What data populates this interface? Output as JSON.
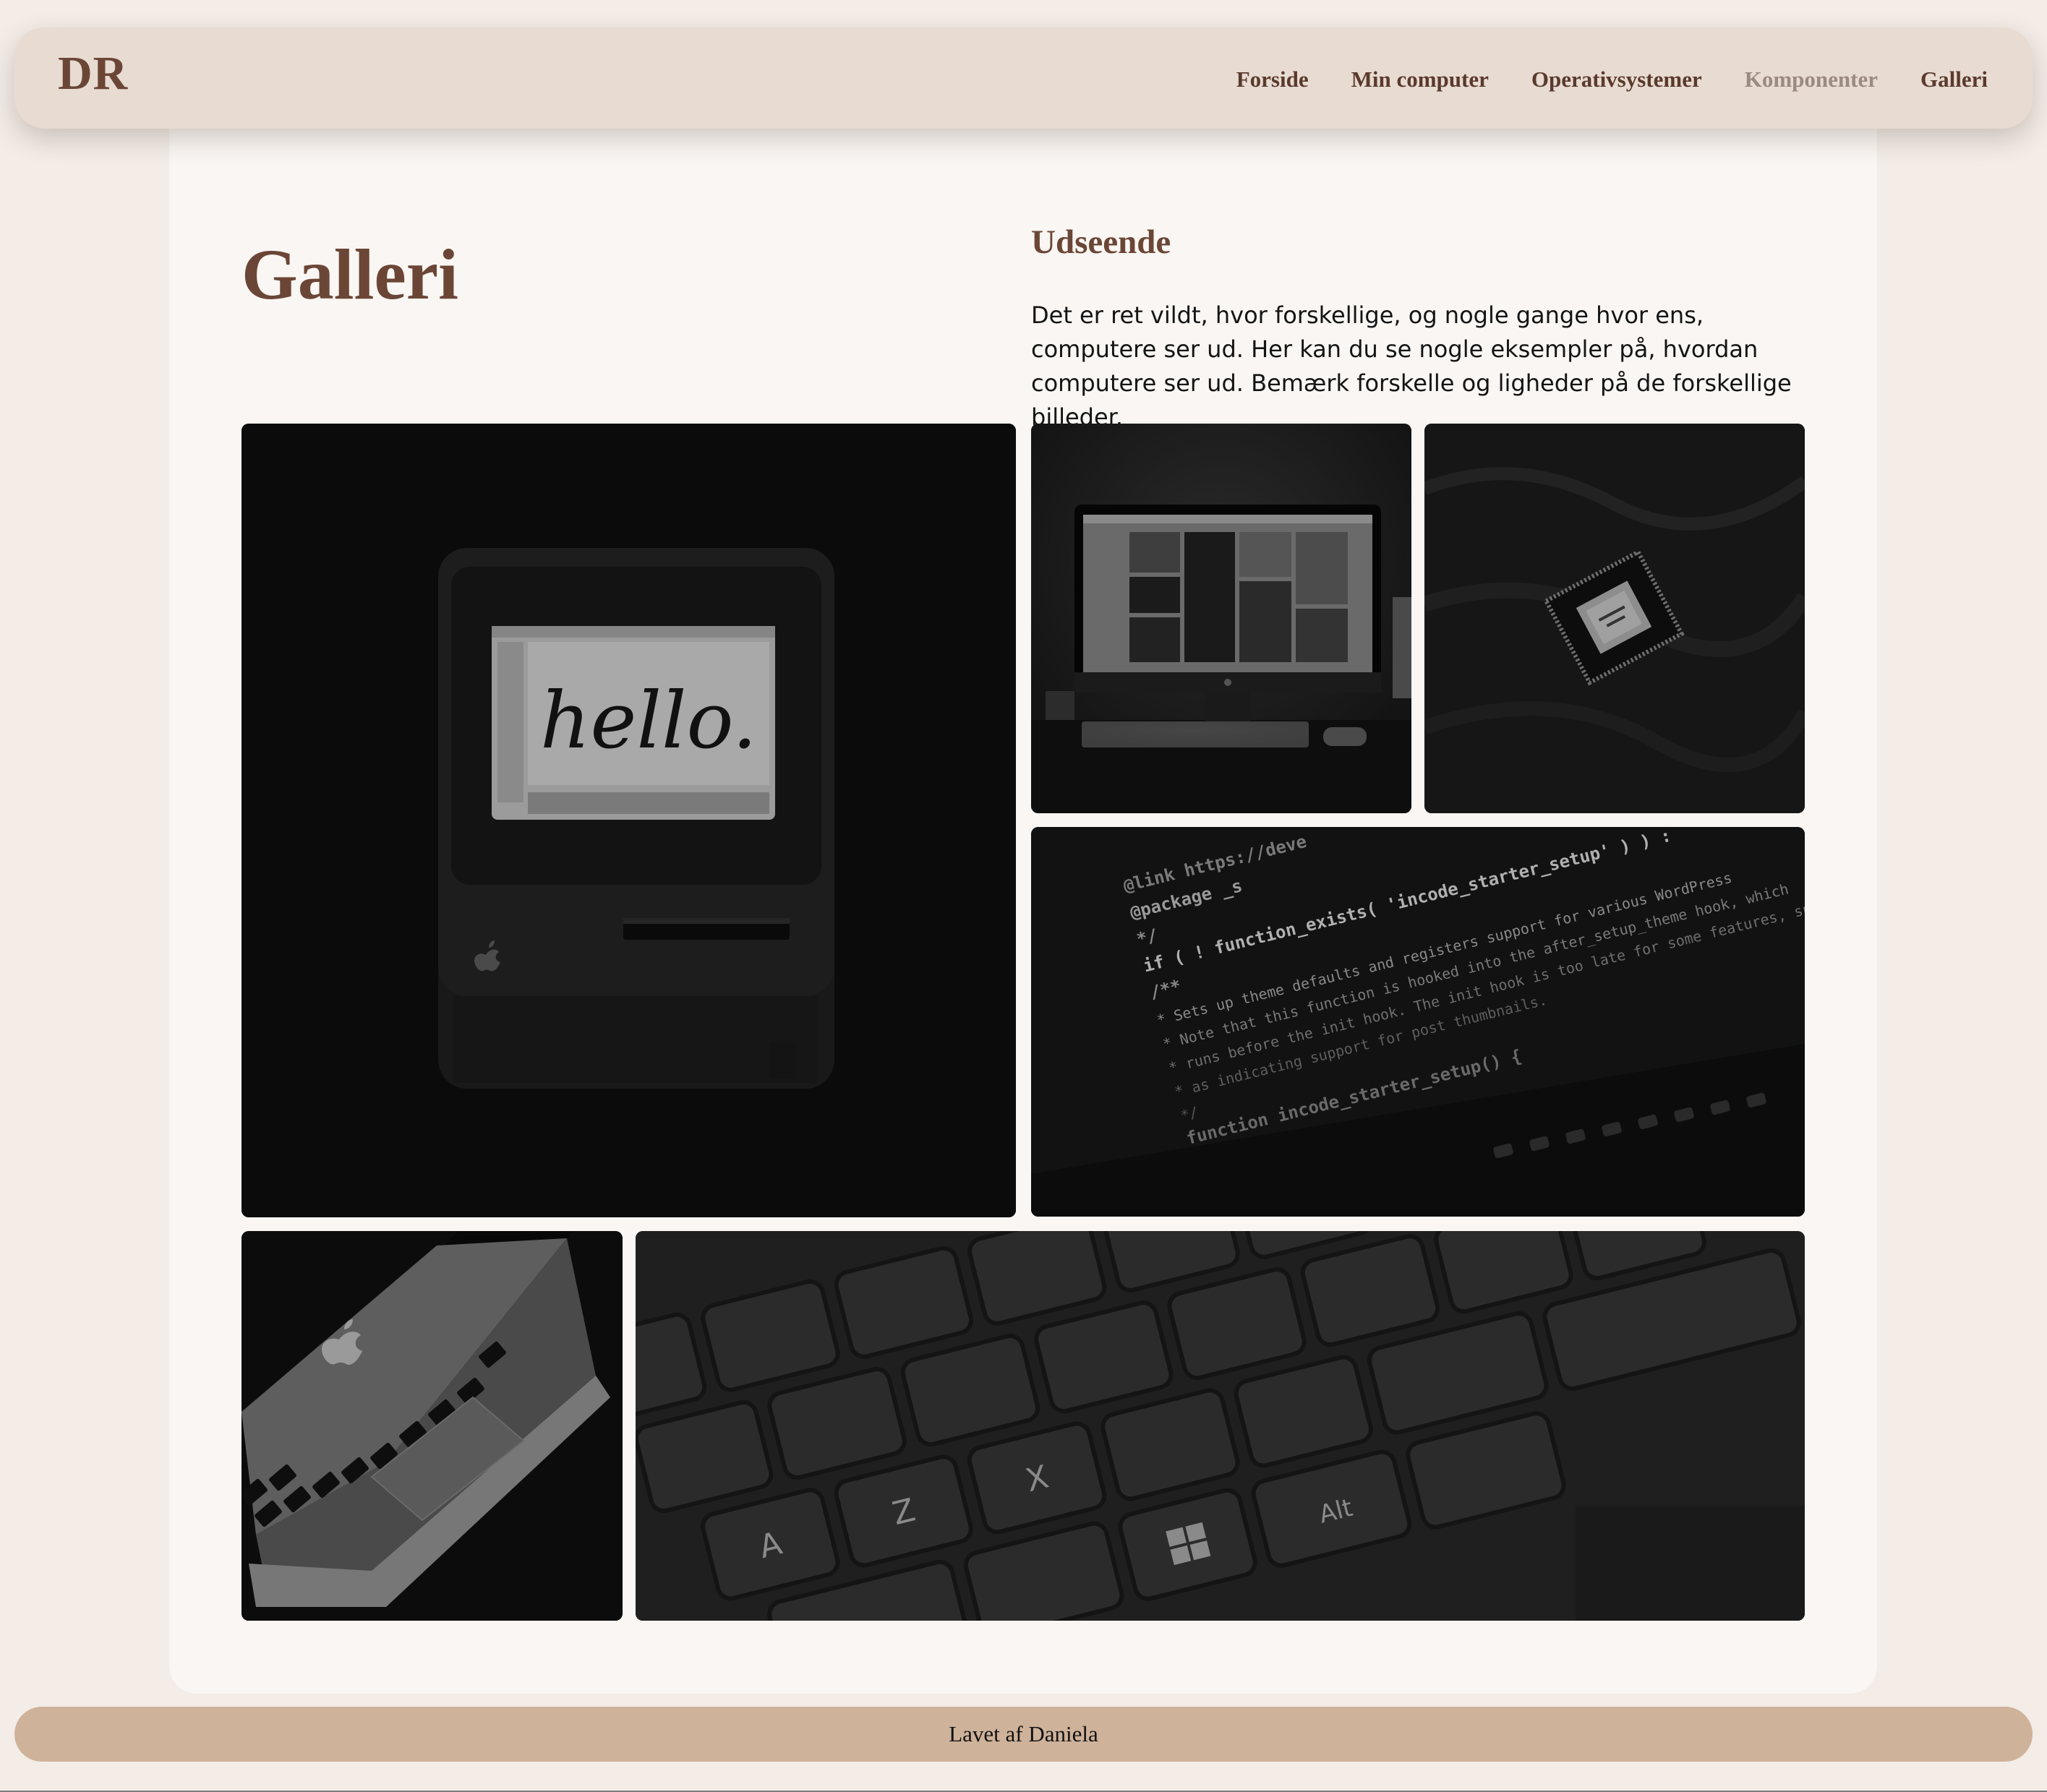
{
  "header": {
    "logo": "DR",
    "nav": [
      {
        "label": "Forside"
      },
      {
        "label": "Min computer"
      },
      {
        "label": "Operativsystemer"
      },
      {
        "label": "Komponenter"
      },
      {
        "label": "Galleri"
      }
    ]
  },
  "main": {
    "title": "Galleri",
    "section_heading": "Udseende",
    "section_body": "Det er ret vildt, hvor forskellige, og nogle gange hvor ens, computere ser ud. Her kan du se nogle eksempler på, hvordan computere ser ud. Bemærk forskelle og ligheder på de forskellige billeder.",
    "gallery": {
      "hello_screen_text": "hello.",
      "code_lines": [
        "@link https://deve",
        "@package _s",
        "*/",
        "if ( ! function_exists( 'incode_starter_setup' ) ) :",
        "/**",
        " * Sets up theme defaults and registers support for various WordPress",
        " * Note that this function is hooked into the after_setup_theme hook, which",
        " * runs before the init hook. The init hook is too late for some features, such",
        " * as indicating support for post thumbnails.",
        " */",
        "function incode_starter_setup() {"
      ],
      "keyboard_keys": [
        "A",
        "Z",
        "X",
        "Alt"
      ]
    }
  },
  "footer": {
    "text": "Lavet af Daniela"
  },
  "colors": {
    "page_bg": "#f3ece7",
    "header_bg": "#e8dbd1",
    "brand_brown": "#6b4636",
    "nav_muted": "#9a8a80",
    "card_bg": "#f9f6f3",
    "footer_bg": "#cfb29a"
  }
}
